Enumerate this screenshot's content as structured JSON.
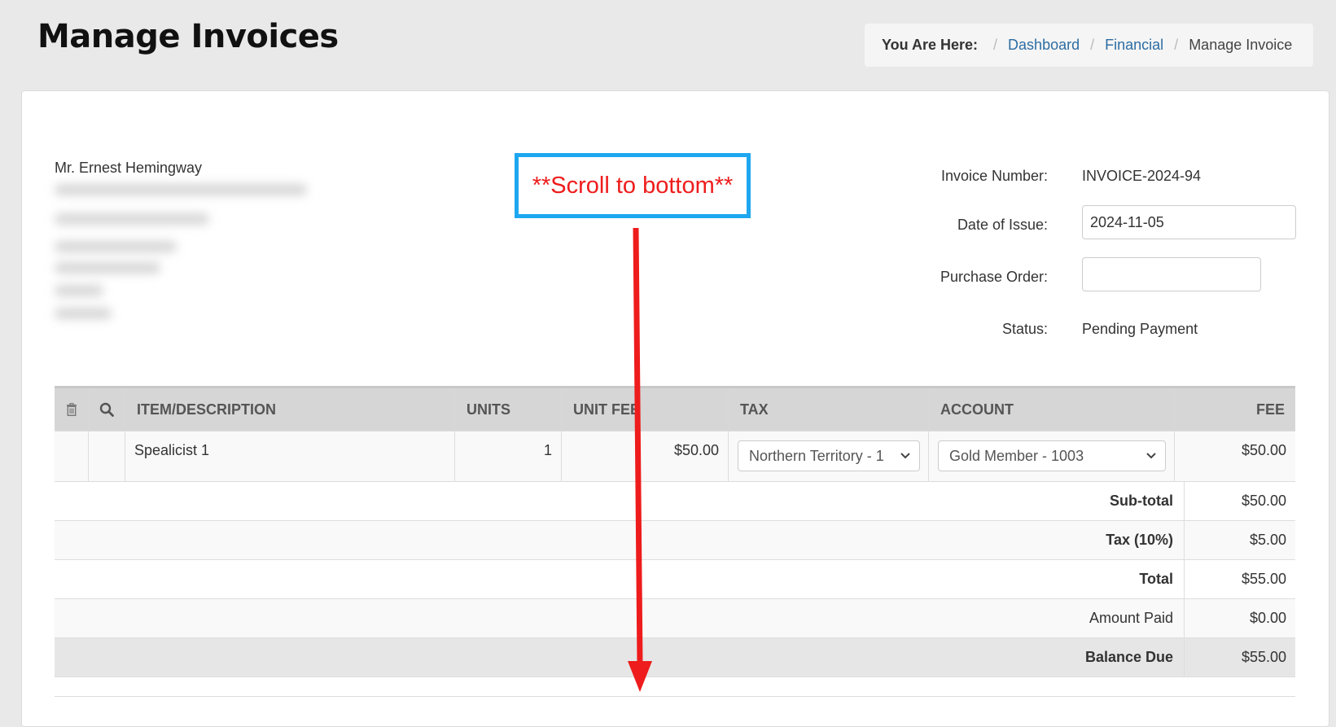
{
  "page": {
    "title": "Manage Invoices"
  },
  "breadcrumb": {
    "lead": "You Are Here:",
    "items": [
      "Dashboard",
      "Financial"
    ],
    "current": "Manage Invoice",
    "separator": "/"
  },
  "customer": {
    "name": "Mr. Ernest Hemingway"
  },
  "invoice": {
    "number_label": "Invoice Number:",
    "number": "INVOICE-2024-94",
    "date_label": "Date of Issue:",
    "date": "2024-11-05",
    "po_label": "Purchase Order:",
    "po": "",
    "status_label": "Status:",
    "status": "Pending Payment"
  },
  "table": {
    "headers": {
      "delete": "trash-icon",
      "search": "search-icon",
      "item": "ITEM/DESCRIPTION",
      "units": "UNITS",
      "unit_fee": "UNIT FEE",
      "tax": "TAX",
      "account": "ACCOUNT",
      "fee": "FEE"
    },
    "rows": [
      {
        "item": "Spealicist 1",
        "units": "1",
        "unit_fee": "$50.00",
        "tax": "Northern Territory - 1",
        "account": "Gold Member - 1003",
        "fee": "$50.00"
      }
    ]
  },
  "summary": {
    "subtotal_label": "Sub-total",
    "subtotal": "$50.00",
    "tax_label": "Tax (10%)",
    "tax": "$5.00",
    "total_label": "Total",
    "total": "$55.00",
    "paid_label": "Amount Paid",
    "paid": "$0.00",
    "balance_label": "Balance Due",
    "balance": "$55.00"
  },
  "annotation": {
    "text": "**Scroll to bottom**",
    "box_color": "#1ea7f0",
    "arrow_color": "#ee1c1c"
  }
}
